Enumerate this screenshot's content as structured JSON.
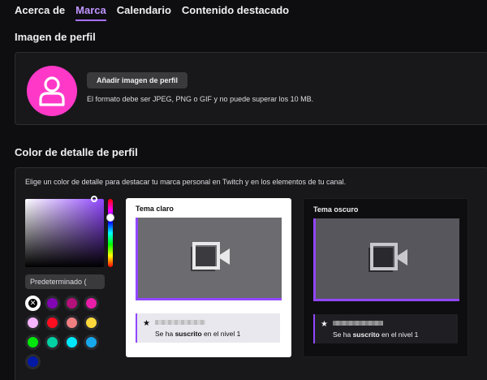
{
  "tabs": [
    {
      "label": "Acerca de",
      "active": false
    },
    {
      "label": "Marca",
      "active": true
    },
    {
      "label": "Calendario",
      "active": false
    },
    {
      "label": "Contenido destacado",
      "active": false
    }
  ],
  "profile_image": {
    "section_title": "Imagen de perfil",
    "upload_button": "Añadir imagen de perfil",
    "hint": "El formato debe ser JPEG, PNG o GIF y no puede superar los 10 MB.",
    "avatar_color": "#ff38c8"
  },
  "accent_color": {
    "section_title": "Color de detalle de perfil",
    "description": "Elige un color de detalle para destacar tu marca personal en Twitch y en los elementos de tu canal.",
    "hex_input_value": "Predeterminado (",
    "swatches": [
      "#000000",
      "#8205b4",
      "#b5117a",
      "#e91ea8",
      "#f7b4ff",
      "#ff0e20",
      "#f07f82",
      "#ffd93b",
      "#00e60a",
      "#00d1a5",
      "#00e8ff",
      "#17a8ec",
      "#0319a5"
    ],
    "selected_swatch": 0,
    "default_accent": "#9147ff"
  },
  "preview_light": {
    "title": "Tema claro",
    "sub_prefix": "Se ha ",
    "sub_bold": "suscrito",
    "sub_suffix": " en el nivel 1"
  },
  "preview_dark": {
    "title": "Tema oscuro",
    "sub_prefix": "Se ha ",
    "sub_bold": "suscrito",
    "sub_suffix": " en el nivel 1"
  }
}
